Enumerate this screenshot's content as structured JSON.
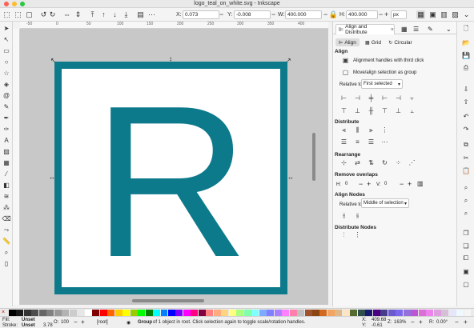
{
  "window": {
    "title": "logo_teal_on_white.svg - Inkscape"
  },
  "toolbar": {
    "x_label": "X:",
    "x_value": "0.073",
    "y_label": "Y:",
    "y_value": "-0.008",
    "w_label": "W:",
    "w_value": "400.000",
    "h_label": "H:",
    "h_value": "400.000",
    "unit": "px"
  },
  "ruler": {
    "ticks": [
      "-50",
      "0",
      "50",
      "100",
      "150",
      "200",
      "250",
      "300",
      "350",
      "400",
      "450"
    ]
  },
  "canvas": {
    "letter": "R",
    "colors": {
      "frame": "#0d7a8c",
      "page": "#ffffff",
      "bg": "#c8c8c8"
    }
  },
  "dock": {
    "tab_active": "Align and Distribute",
    "subtabs": [
      "Align",
      "Grid",
      "Circular"
    ],
    "align_section": "Align",
    "align_handles_label": "Alignment handles with third click",
    "move_group_label": "Move/align selection as group",
    "relative_to_label": "Relative to:",
    "relative_to_value": "First selected",
    "distribute_section": "Distribute",
    "rearrange_section": "Rearrange",
    "remove_overlaps_section": "Remove overlaps",
    "h_label": "H:",
    "h_value": "0",
    "v_label": "V:",
    "v_value": "0",
    "align_nodes_section": "Align Nodes",
    "nodes_relative_label": "Relative to:",
    "nodes_relative_value": "Middle of selection",
    "distribute_nodes_section": "Distribute Nodes"
  },
  "status": {
    "fill_label": "Fill:",
    "fill_value": "Unset",
    "stroke_label": "Stroke:",
    "stroke_value": "Unset",
    "stroke_width": "3.78",
    "opacity_label": "O:",
    "opacity_value": "100",
    "layer": "[root]",
    "message_bold": "Group",
    "message_rest": " of 1 object in root. Click selection again to toggle scale/rotation handles.",
    "x_label": "X:",
    "x_value": "409.68",
    "y_label": "Y:",
    "y_value": "-0.61",
    "zoom_label": "Z:",
    "zoom_value": "163%",
    "rot_label": "R:",
    "rot_value": "0.00°"
  },
  "palette": {
    "colors": [
      "#000000",
      "#1a1a1a",
      "#333333",
      "#4d4d4d",
      "#666666",
      "#808080",
      "#999999",
      "#b3b3b3",
      "#cccccc",
      "#e6e6e6",
      "#ffffff",
      "#800000",
      "#ff0000",
      "#ff6600",
      "#ffcc00",
      "#ffff00",
      "#99cc00",
      "#00ff00",
      "#008000",
      "#00ffff",
      "#0080ff",
      "#0000ff",
      "#8000ff",
      "#ff00ff",
      "#ff0080",
      "#800040",
      "#ff8080",
      "#ffaa80",
      "#ffd480",
      "#ffff80",
      "#aaff80",
      "#80ffaa",
      "#80ffff",
      "#80aaff",
      "#8080ff",
      "#aa80ff",
      "#ff80ff",
      "#ff80aa",
      "#c0c0c0",
      "#a0522d",
      "#8b4513",
      "#d2691e",
      "#f4a460",
      "#deb887",
      "#ffe4c4",
      "#556b2f",
      "#2f4f4f",
      "#191970",
      "#4b0082",
      "#483d8b",
      "#6a5acd",
      "#7b68ee",
      "#9370db",
      "#ba55d3",
      "#da70d6",
      "#ee82ee",
      "#dda0dd",
      "#d8bfd8",
      "#e6e6fa",
      "#f0f8ff",
      "#f5f5f5"
    ]
  }
}
